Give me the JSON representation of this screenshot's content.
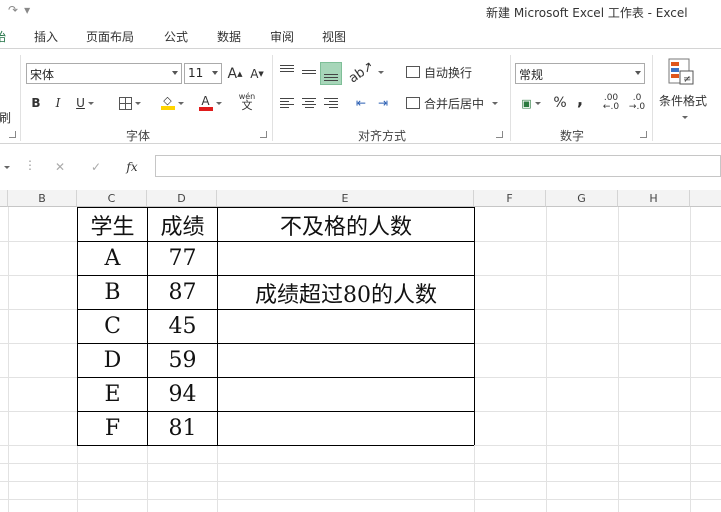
{
  "window": {
    "title": "新建 Microsoft Excel 工作表 - Excel"
  },
  "tabs": [
    "始",
    "插入",
    "页面布局",
    "公式",
    "数据",
    "审阅",
    "视图"
  ],
  "ribbon": {
    "clipboard_partial": "刷",
    "font_name": "宋体",
    "font_size": "11",
    "grow_font": "A",
    "shrink_font": "A",
    "bold": "B",
    "italic": "I",
    "underline": "U",
    "wen": "wén",
    "wen_char": "文",
    "font_group": "字体",
    "wrap_text": "自动换行",
    "merge_center": "合并后居中",
    "align_group": "对齐方式",
    "number_format": "常规",
    "percent": "%",
    "comma": ",",
    "inc_decimal": ".00",
    "dec_decimal": ".0",
    "number_group": "数字",
    "cond_format": "条件格式",
    "colors": {
      "fill": "#ffd400",
      "font": "#e01b1b",
      "active_align": "#a7d6b9",
      "accent": "#217346"
    }
  },
  "formula_bar": {
    "cancel": "✕",
    "enter": "✓",
    "fx": "fx",
    "value": ""
  },
  "columns": [
    "B",
    "C",
    "D",
    "E",
    "F",
    "G",
    "H"
  ],
  "sheet": {
    "headers": [
      "学生",
      "成绩",
      "不及格的人数"
    ],
    "rows": [
      [
        "A",
        "77",
        ""
      ],
      [
        "B",
        "87",
        "成绩超过80的人数"
      ],
      [
        "C",
        "45",
        ""
      ],
      [
        "D",
        "59",
        ""
      ],
      [
        "E",
        "94",
        ""
      ],
      [
        "F",
        "81",
        ""
      ]
    ]
  }
}
